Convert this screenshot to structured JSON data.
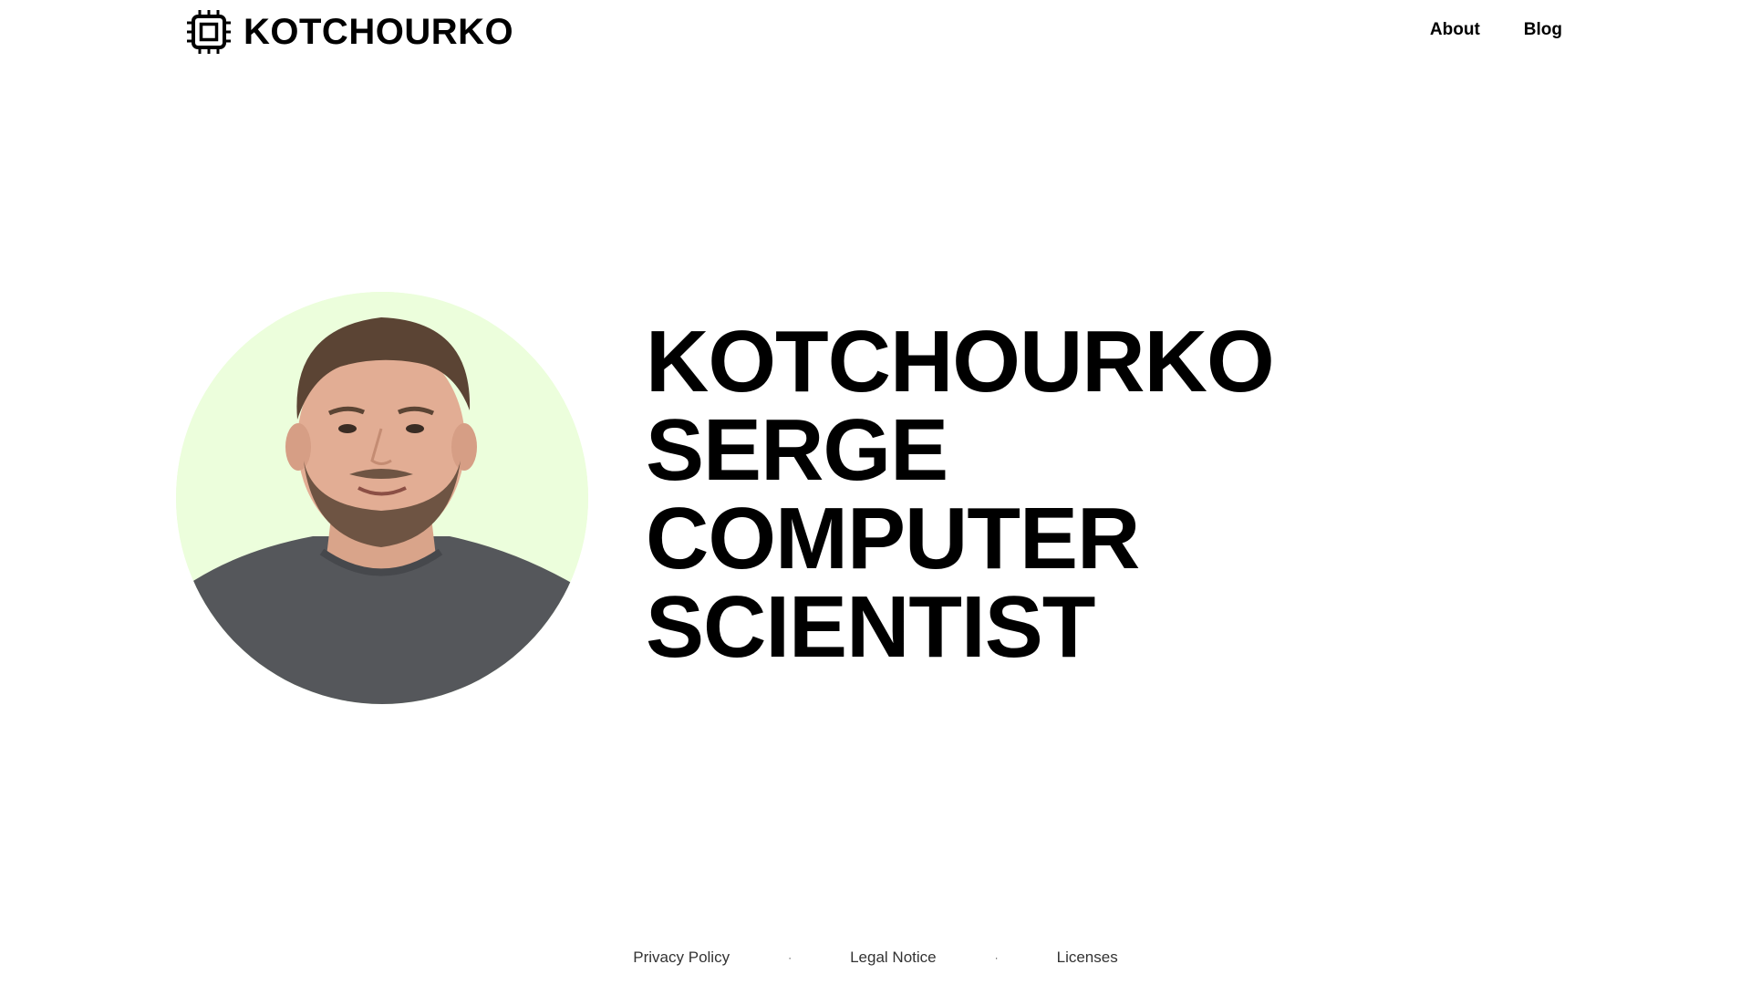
{
  "header": {
    "brand_name": "KOTCHOURKO",
    "brand_icon": "cpu-chip-icon",
    "nav": {
      "about": "About",
      "blog": "Blog"
    }
  },
  "hero": {
    "lines": [
      "KOTCHOURKO",
      "SERGE",
      "COMPUTER",
      "SCIENTIST"
    ],
    "portrait_background": "#ecfedc"
  },
  "footer": {
    "privacy": "Privacy Policy",
    "legal": "Legal Notice",
    "licenses": "Licenses",
    "separator": "·"
  }
}
